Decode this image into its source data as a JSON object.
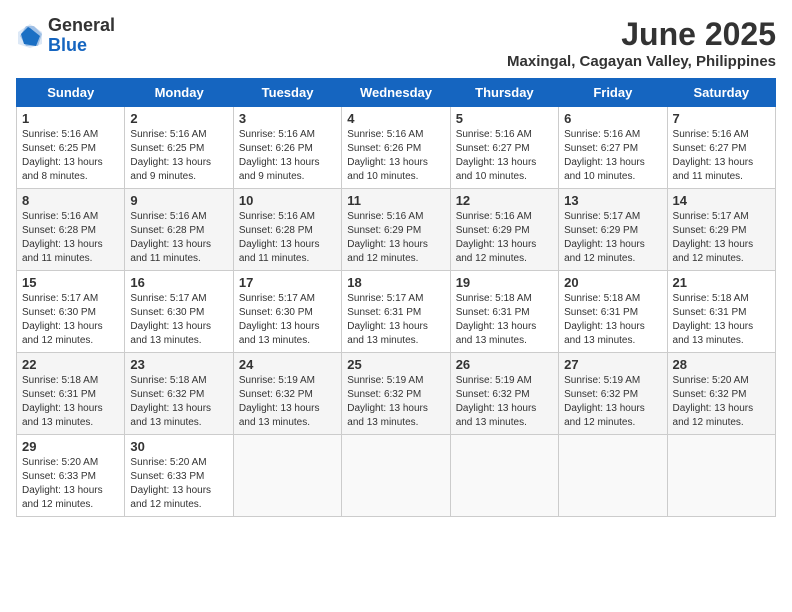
{
  "logo": {
    "general": "General",
    "blue": "Blue"
  },
  "title": {
    "month_year": "June 2025",
    "location": "Maxingal, Cagayan Valley, Philippines"
  },
  "weekdays": [
    "Sunday",
    "Monday",
    "Tuesday",
    "Wednesday",
    "Thursday",
    "Friday",
    "Saturday"
  ],
  "weeks": [
    [
      {
        "day": "1",
        "sunrise": "5:16 AM",
        "sunset": "6:25 PM",
        "daylight": "13 hours and 8 minutes."
      },
      {
        "day": "2",
        "sunrise": "5:16 AM",
        "sunset": "6:25 PM",
        "daylight": "13 hours and 9 minutes."
      },
      {
        "day": "3",
        "sunrise": "5:16 AM",
        "sunset": "6:26 PM",
        "daylight": "13 hours and 9 minutes."
      },
      {
        "day": "4",
        "sunrise": "5:16 AM",
        "sunset": "6:26 PM",
        "daylight": "13 hours and 10 minutes."
      },
      {
        "day": "5",
        "sunrise": "5:16 AM",
        "sunset": "6:27 PM",
        "daylight": "13 hours and 10 minutes."
      },
      {
        "day": "6",
        "sunrise": "5:16 AM",
        "sunset": "6:27 PM",
        "daylight": "13 hours and 10 minutes."
      },
      {
        "day": "7",
        "sunrise": "5:16 AM",
        "sunset": "6:27 PM",
        "daylight": "13 hours and 11 minutes."
      }
    ],
    [
      {
        "day": "8",
        "sunrise": "5:16 AM",
        "sunset": "6:28 PM",
        "daylight": "13 hours and 11 minutes."
      },
      {
        "day": "9",
        "sunrise": "5:16 AM",
        "sunset": "6:28 PM",
        "daylight": "13 hours and 11 minutes."
      },
      {
        "day": "10",
        "sunrise": "5:16 AM",
        "sunset": "6:28 PM",
        "daylight": "13 hours and 11 minutes."
      },
      {
        "day": "11",
        "sunrise": "5:16 AM",
        "sunset": "6:29 PM",
        "daylight": "13 hours and 12 minutes."
      },
      {
        "day": "12",
        "sunrise": "5:16 AM",
        "sunset": "6:29 PM",
        "daylight": "13 hours and 12 minutes."
      },
      {
        "day": "13",
        "sunrise": "5:17 AM",
        "sunset": "6:29 PM",
        "daylight": "13 hours and 12 minutes."
      },
      {
        "day": "14",
        "sunrise": "5:17 AM",
        "sunset": "6:29 PM",
        "daylight": "13 hours and 12 minutes."
      }
    ],
    [
      {
        "day": "15",
        "sunrise": "5:17 AM",
        "sunset": "6:30 PM",
        "daylight": "13 hours and 12 minutes."
      },
      {
        "day": "16",
        "sunrise": "5:17 AM",
        "sunset": "6:30 PM",
        "daylight": "13 hours and 13 minutes."
      },
      {
        "day": "17",
        "sunrise": "5:17 AM",
        "sunset": "6:30 PM",
        "daylight": "13 hours and 13 minutes."
      },
      {
        "day": "18",
        "sunrise": "5:17 AM",
        "sunset": "6:31 PM",
        "daylight": "13 hours and 13 minutes."
      },
      {
        "day": "19",
        "sunrise": "5:18 AM",
        "sunset": "6:31 PM",
        "daylight": "13 hours and 13 minutes."
      },
      {
        "day": "20",
        "sunrise": "5:18 AM",
        "sunset": "6:31 PM",
        "daylight": "13 hours and 13 minutes."
      },
      {
        "day": "21",
        "sunrise": "5:18 AM",
        "sunset": "6:31 PM",
        "daylight": "13 hours and 13 minutes."
      }
    ],
    [
      {
        "day": "22",
        "sunrise": "5:18 AM",
        "sunset": "6:31 PM",
        "daylight": "13 hours and 13 minutes."
      },
      {
        "day": "23",
        "sunrise": "5:18 AM",
        "sunset": "6:32 PM",
        "daylight": "13 hours and 13 minutes."
      },
      {
        "day": "24",
        "sunrise": "5:19 AM",
        "sunset": "6:32 PM",
        "daylight": "13 hours and 13 minutes."
      },
      {
        "day": "25",
        "sunrise": "5:19 AM",
        "sunset": "6:32 PM",
        "daylight": "13 hours and 13 minutes."
      },
      {
        "day": "26",
        "sunrise": "5:19 AM",
        "sunset": "6:32 PM",
        "daylight": "13 hours and 13 minutes."
      },
      {
        "day": "27",
        "sunrise": "5:19 AM",
        "sunset": "6:32 PM",
        "daylight": "13 hours and 12 minutes."
      },
      {
        "day": "28",
        "sunrise": "5:20 AM",
        "sunset": "6:32 PM",
        "daylight": "13 hours and 12 minutes."
      }
    ],
    [
      {
        "day": "29",
        "sunrise": "5:20 AM",
        "sunset": "6:33 PM",
        "daylight": "13 hours and 12 minutes."
      },
      {
        "day": "30",
        "sunrise": "5:20 AM",
        "sunset": "6:33 PM",
        "daylight": "13 hours and 12 minutes."
      },
      null,
      null,
      null,
      null,
      null
    ]
  ]
}
